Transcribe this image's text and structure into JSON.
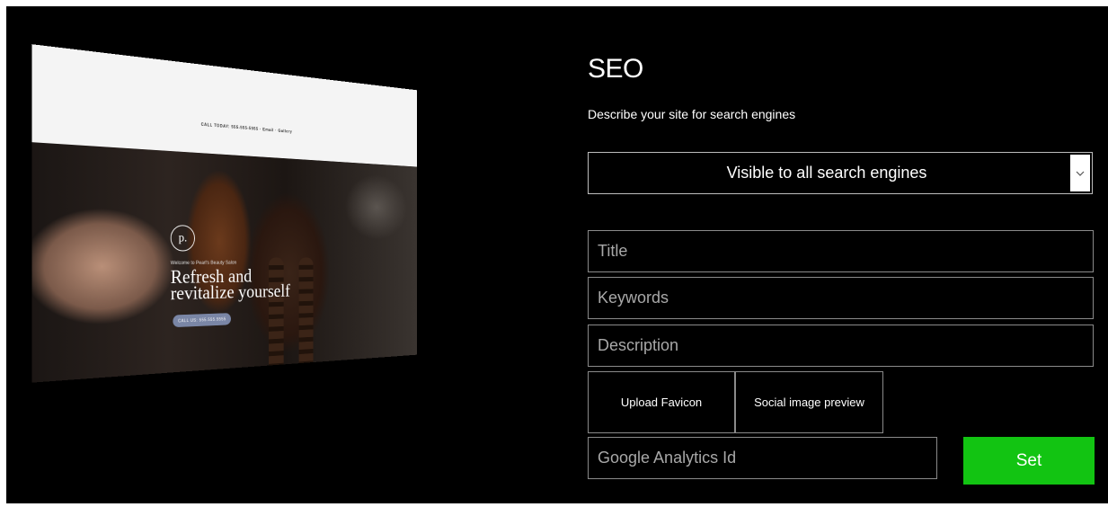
{
  "preview": {
    "header_text": "CALL TODAY: 555-555-5555 · Email · Gallery",
    "logo_letter": "p.",
    "welcome": "Welcome to Pearl's Beauty Salon",
    "headline_line1": "Refresh and",
    "headline_line2": "revitalize yourself",
    "cta_label": "CALL US: 555.555.5555"
  },
  "seo": {
    "title": "SEO",
    "subtitle": "Describe your site for search engines",
    "visibility_value": "Visible to all search engines",
    "title_placeholder": "Title",
    "keywords_placeholder": "Keywords",
    "description_placeholder": "Description",
    "upload_favicon_label": "Upload Favicon",
    "social_preview_label": "Social image preview",
    "ga_placeholder": "Google Analytics Id",
    "set_label": "Set"
  },
  "colors": {
    "background": "#000000",
    "set_button": "#12c412",
    "cta": "#7a86a6"
  },
  "icons": {
    "dropdown": "chevron-down-icon"
  }
}
